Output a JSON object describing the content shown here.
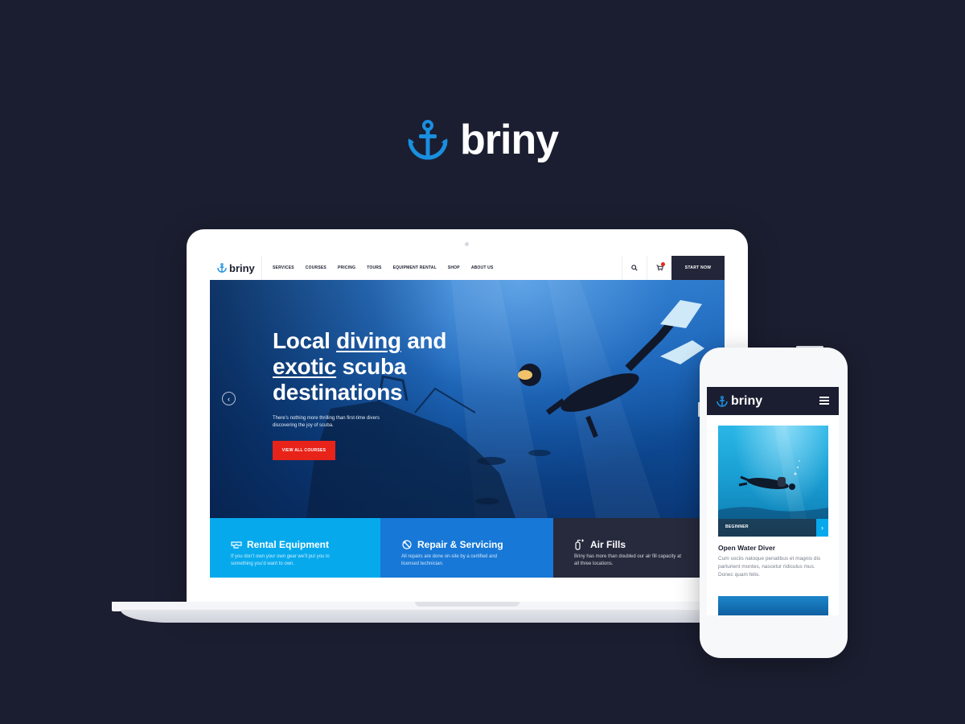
{
  "brand": {
    "name": "briny"
  },
  "desktop": {
    "nav": {
      "logo": "briny",
      "links": [
        "SERVICES",
        "COURSES",
        "PRICING",
        "TOURS",
        "EQUIPMENT RENTAL",
        "SHOP",
        "ABOUT US"
      ],
      "cta": "START NOW"
    },
    "hero": {
      "title_line1_a": "Local ",
      "title_line1_b": "diving",
      "title_line1_c": " and",
      "title_line2_a": "exotic",
      "title_line2_b": " scuba",
      "title_line3": "destinations",
      "subtitle": "There’s nothing more thrilling than first-time divers discovering the joy of scuba.",
      "button": "VIEW ALL COURSES"
    },
    "features": [
      {
        "title": "Rental Equipment",
        "text": "If you don’t own your own gear we’ll put you in something you’d want to own.",
        "icon": "mask-icon"
      },
      {
        "title": "Repair & Servicing",
        "text": "All repairs are done on-site by a certified and licensed technician.",
        "icon": "wrench-icon"
      },
      {
        "title": "Air Fills",
        "text": "Briny has more than doubled our air fill capacity at all three locations.",
        "icon": "air-tank-icon"
      }
    ]
  },
  "mobile": {
    "nav": {
      "logo": "briny"
    },
    "card": {
      "badge": "BEGINNER",
      "title": "Open Water Diver",
      "text": "Cum sociis natoque penatibus et magnis dis parturient montes, nascetur ridiculus mus. Donec quam felis."
    }
  },
  "colors": {
    "background": "#1b1e30",
    "accent_blue": "#07a9ed",
    "accent_mid_blue": "#1778d7",
    "dark": "#262a3c",
    "cta_red": "#e8231a"
  }
}
